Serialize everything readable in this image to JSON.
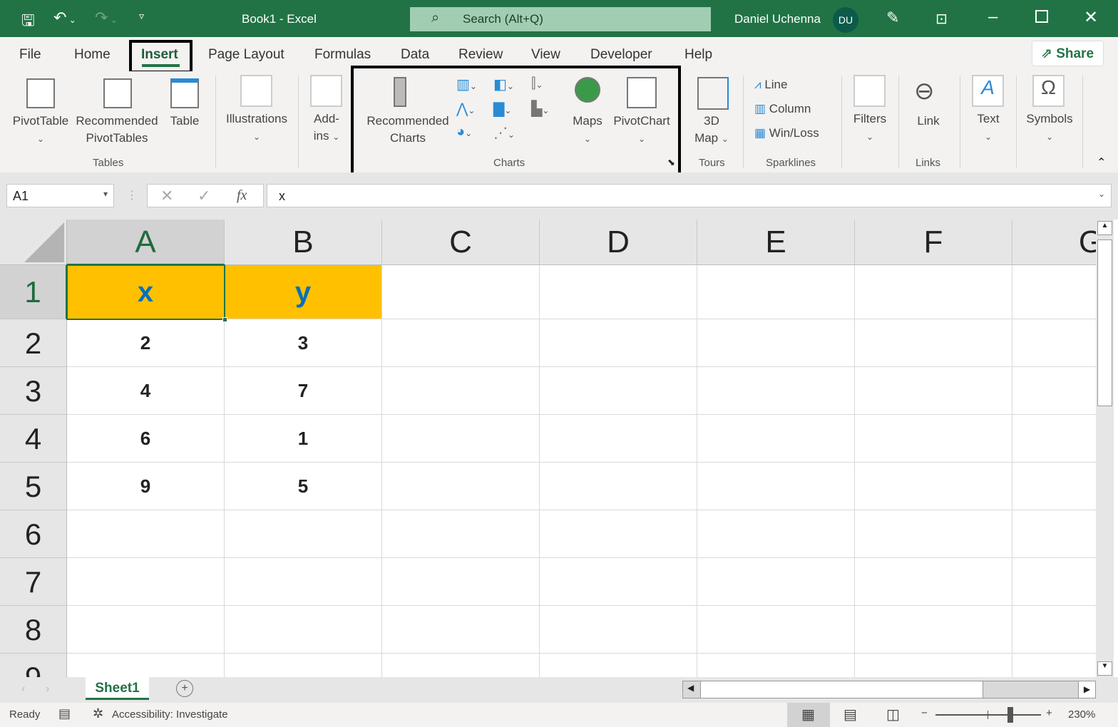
{
  "titlebar": {
    "title": "Book1  -  Excel",
    "search_placeholder": "Search (Alt+Q)",
    "user": "Daniel Uchenna",
    "initials": "DU"
  },
  "tabs": [
    "File",
    "Home",
    "Insert",
    "Page Layout",
    "Formulas",
    "Data",
    "Review",
    "View",
    "Developer",
    "Help"
  ],
  "active_tab": "Insert",
  "share_label": "Share",
  "ribbon": {
    "pivottable": "PivotTable",
    "recommended_pivottables_1": "Recommended",
    "recommended_pivottables_2": "PivotTables",
    "table": "Table",
    "tables_group": "Tables",
    "illustrations": "Illustrations",
    "addins_1": "Add-",
    "addins_2": "ins",
    "recommended_charts_1": "Recommended",
    "recommended_charts_2": "Charts",
    "maps": "Maps",
    "pivotchart": "PivotChart",
    "charts_group": "Charts",
    "map3d_1": "3D",
    "map3d_2": "Map",
    "tours_group": "Tours",
    "line": "Line",
    "column": "Column",
    "winloss": "Win/Loss",
    "sparklines_group": "Sparklines",
    "filters": "Filters",
    "link": "Link",
    "links_group": "Links",
    "text": "Text",
    "symbols": "Symbols"
  },
  "formula_bar": {
    "name_box": "A1",
    "fx": "fx",
    "value": "x"
  },
  "columns": [
    "A",
    "B",
    "C",
    "D",
    "E",
    "F",
    "G"
  ],
  "rows": [
    "1",
    "2",
    "3",
    "4",
    "5",
    "6",
    "7",
    "8",
    "9"
  ],
  "cells": [
    [
      "x",
      "y"
    ],
    [
      "2",
      "3"
    ],
    [
      "4",
      "7"
    ],
    [
      "6",
      "1"
    ],
    [
      "9",
      "5"
    ]
  ],
  "header_fill": "#ffc000",
  "header_text_color": "#0070c0",
  "sheet_tab": "Sheet1",
  "status": {
    "ready": "Ready",
    "accessibility": "Accessibility: Investigate",
    "zoom": "230%",
    "zoom_percent": 230
  }
}
